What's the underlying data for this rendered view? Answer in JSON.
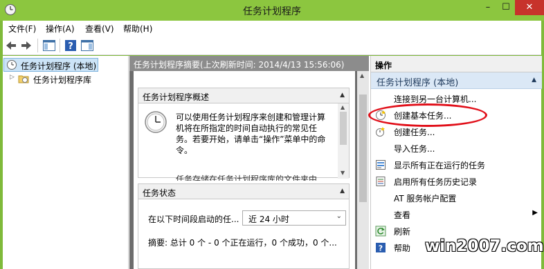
{
  "window": {
    "title": "任务计划程序",
    "minimize": "–",
    "maximize": "☐",
    "close": "✕"
  },
  "menu": [
    "文件(F)",
    "操作(A)",
    "查看(V)",
    "帮助(H)"
  ],
  "toolbar": {
    "icons": [
      "back-arrow-icon",
      "forward-arrow-icon",
      "show-hide-console-tree-icon",
      "help-icon",
      "show-hide-action-pane-icon"
    ]
  },
  "tree": {
    "root": "任务计划程序 (本地)",
    "child": "任务计划程序库"
  },
  "middle": {
    "header": "任务计划程序摘要(上次刷新时间: 2014/4/13 15:56:06)",
    "overview": {
      "title": "任务计划程序概述",
      "text": "可以使用任务计划程序来创建和管理计算机将在所指定的时间自动执行的常见任务。若要开始，请单击“操作”菜单中的命令。",
      "text2": "任务存储在任务计划程序库的文件夹中"
    },
    "status": {
      "title": "任务状态",
      "filter_label": "在以下时间段启动的任...",
      "filter_value": "近 24 小时",
      "summary": "摘要: 总计 0 个 - 0 个正在运行，0 个成功，0 个..."
    }
  },
  "actions": {
    "header": "操作",
    "group": "任务计划程序 (本地)",
    "items": [
      {
        "label": "连接到另一台计算机...",
        "icon": ""
      },
      {
        "label": "创建基本任务...",
        "icon": "basic-task-wizard-icon"
      },
      {
        "label": "创建任务...",
        "icon": "create-task-icon"
      },
      {
        "label": "导入任务...",
        "icon": ""
      },
      {
        "label": "显示所有正在运行的任务",
        "icon": "running-tasks-icon"
      },
      {
        "label": "启用所有任务历史记录",
        "icon": "task-history-icon"
      },
      {
        "label": "AT 服务帐户配置",
        "icon": ""
      },
      {
        "label": "查看",
        "icon": ""
      },
      {
        "label": "刷新",
        "icon": "refresh-icon"
      },
      {
        "label": "帮助",
        "icon": "help-icon"
      }
    ]
  },
  "watermark": "win2007.com",
  "colors": {
    "titlebar": "#8cc63f",
    "selection": "#cce4f7",
    "action_group": "#dbe8f6",
    "annotation_red": "#e1101a"
  }
}
